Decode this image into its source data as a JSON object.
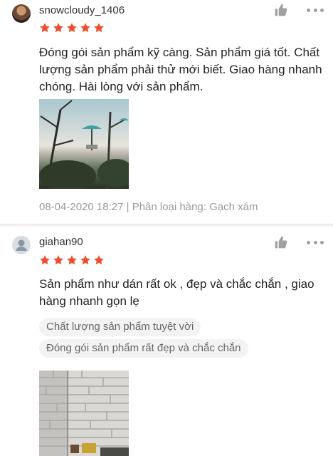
{
  "reviews": [
    {
      "username": "snowcloudy_1406",
      "rating": 5,
      "text": "Đóng gói sản phẩm kỹ càng. Sản phẩm giá tốt. Chất lượng sản phẩm phải thử mới biết. Giao hàng nhanh chóng. Hài lòng với sản phẩm.",
      "date": "08-04-2020 18:27",
      "separator": "|",
      "variation_label": "Phân loại hàng:",
      "variation_value": "Gạch xám",
      "icons": [
        "avatar",
        "star-icon",
        "like-icon",
        "more-icon"
      ]
    },
    {
      "username": "giahan90",
      "rating": 5,
      "text": "Sản phẩm như dán rất ok , đẹp và chắc chắn , giao hàng nhanh gọn lẹ",
      "tags": [
        "Chất lượng sản phẩm tuyệt vời",
        "Đóng gói sản phẩm rất đẹp và chắc chắn"
      ],
      "icons": [
        "default-avatar-icon",
        "star-icon",
        "like-icon",
        "more-icon"
      ]
    }
  ],
  "colors": {
    "star": "#ee4d2d",
    "meta_text": "#9a9a9a",
    "tag_bg": "#f3f3f3",
    "icon_gray": "#a0a0a0"
  }
}
